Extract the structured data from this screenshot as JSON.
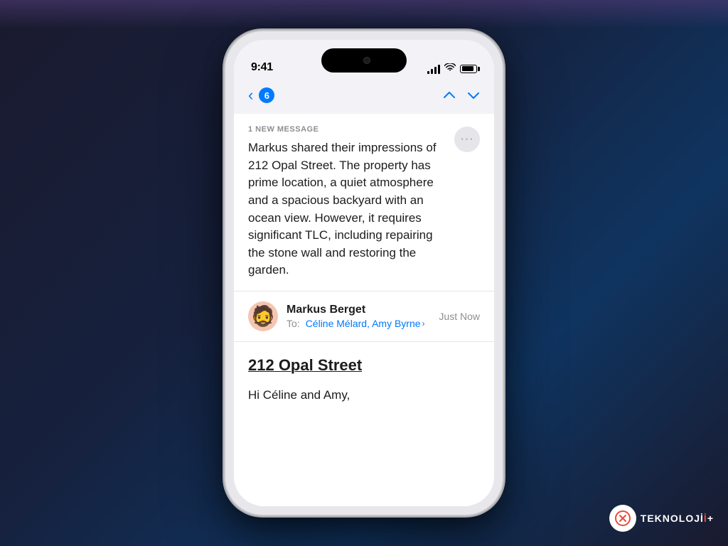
{
  "status_bar": {
    "time": "9:41",
    "signal_bars": [
      4,
      7,
      10,
      13
    ],
    "battery_level": "85%"
  },
  "nav": {
    "back_icon": "chevron-left",
    "badge_count": "6",
    "prev_icon": "chevron-up",
    "next_icon": "chevron-down"
  },
  "summary_banner": {
    "label": "1 NEW MESSAGE",
    "body": "Markus shared their impressions of 212 Opal Street. The property has prime location, a quiet atmosphere and a spacious backyard with an ocean view. However, it requires significant TLC, including repairing the stone wall and restoring the garden.",
    "more_button_label": "···"
  },
  "sender": {
    "name": "Markus Berget",
    "to_label": "To:",
    "recipients": "Céline Mélard, Amy Byrne",
    "time": "Just Now",
    "avatar_emoji": "🧔"
  },
  "email": {
    "subject": "212 Opal Street",
    "greeting": "Hi Céline and Amy,"
  },
  "watermark": {
    "text": "TEKNOLOJİ"
  }
}
